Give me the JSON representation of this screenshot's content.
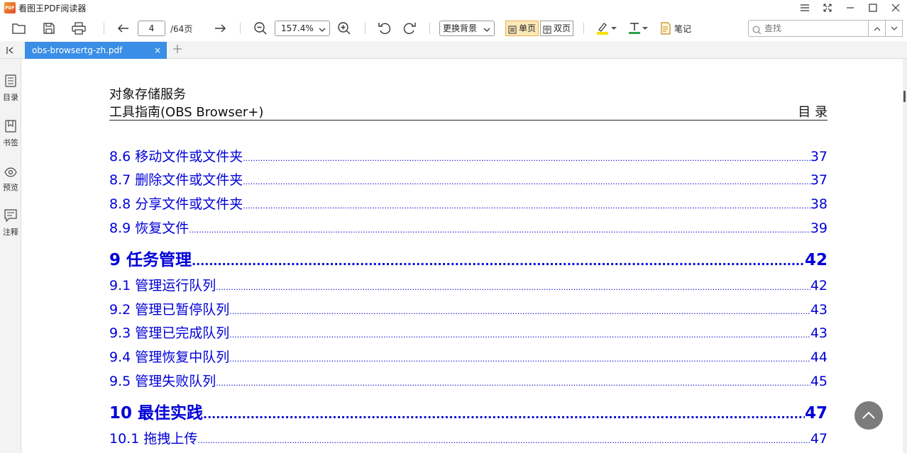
{
  "window": {
    "app_title": "看图王PDF阅读器",
    "logo_text": "PDF"
  },
  "toolbar": {
    "current_page": "4",
    "total_pages": "/64页",
    "zoom": "157.4%",
    "background_label": "更换背景",
    "single_page_label": "单页",
    "double_page_label": "双页",
    "notes_label": "笔记",
    "search_placeholder": "查找",
    "highlight_color": "#f5e000",
    "text_color": "#2aa24a"
  },
  "tab": {
    "filename": "obs-browsertg-zh.pdf",
    "close": "×"
  },
  "sidebar": {
    "items": [
      {
        "label": "目录",
        "icon": "toc-icon"
      },
      {
        "label": "书签",
        "icon": "bookmark-icon"
      },
      {
        "label": "预览",
        "icon": "eye-icon"
      },
      {
        "label": "注释",
        "icon": "comment-icon"
      }
    ]
  },
  "document": {
    "header_title": "对象存储服务",
    "header_subtitle": "工具指南(OBS Browser+)",
    "header_right": "目 录",
    "toc": [
      {
        "title": "8.6 移动文件或文件夹",
        "page": "37",
        "level": "sub"
      },
      {
        "title": "8.7 删除文件或文件夹",
        "page": "37",
        "level": "sub"
      },
      {
        "title": "8.8 分享文件或文件夹",
        "page": "38",
        "level": "sub"
      },
      {
        "title": "8.9 恢复文件",
        "page": "39",
        "level": "sub"
      },
      {
        "title": "9 任务管理",
        "page": "42",
        "level": "chap"
      },
      {
        "title": "9.1 管理运行队列",
        "page": "42",
        "level": "sub"
      },
      {
        "title": "9.2 管理已暂停队列",
        "page": "43",
        "level": "sub"
      },
      {
        "title": "9.3 管理已完成队列",
        "page": "43",
        "level": "sub"
      },
      {
        "title": "9.4 管理恢复中队列",
        "page": "44",
        "level": "sub"
      },
      {
        "title": "9.5 管理失败队列",
        "page": "45",
        "level": "sub"
      },
      {
        "title": "10 最佳实践",
        "page": "47",
        "level": "chap"
      },
      {
        "title": "10.1 拖拽上传",
        "page": "47",
        "level": "sub"
      }
    ],
    "link_color": "#0000d8"
  }
}
